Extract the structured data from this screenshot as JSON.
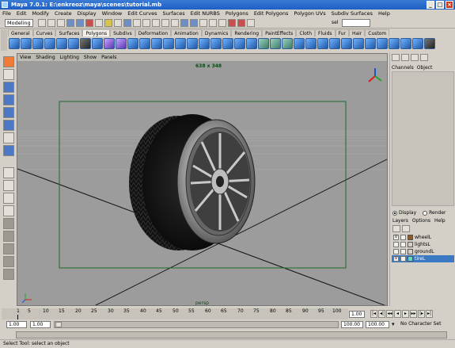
{
  "window": {
    "title": "Maya 7.0.1: E:\\enkreoz\\maya\\scenes\\tutorial.mb"
  },
  "menubar": [
    "File",
    "Edit",
    "Modify",
    "Create",
    "Display",
    "Window",
    "Edit Curves",
    "Surfaces",
    "Edit NURBS",
    "Polygons",
    "Edit Polygons",
    "Polygon UVs",
    "Subdiv Surfaces",
    "Help"
  ],
  "status_line": {
    "mode": "Modeling",
    "sel_label": "sel"
  },
  "shelf_tabs": [
    "General",
    "Curves",
    "Surfaces",
    "Polygons",
    "Subdivs",
    "Deformation",
    "Animation",
    "Dynamics",
    "Rendering",
    "PaintEffects",
    "Cloth",
    "Fluids",
    "Fur",
    "Hair",
    "Custom"
  ],
  "active_shelf": "Polygons",
  "viewport": {
    "menu": [
      "View",
      "Shading",
      "Lighting",
      "Show",
      "Panels"
    ],
    "resolution_gate": "638 x 348",
    "camera": "persp"
  },
  "channel_box": {
    "tabs": [
      "Channels",
      "Object"
    ]
  },
  "layer_editor": {
    "display_label": "Display",
    "render_label": "Render",
    "menu": [
      "Layers",
      "Options",
      "Help"
    ],
    "layers": [
      {
        "visible": "V",
        "name": "wheelL",
        "color": "#8a5a2b",
        "selected": false
      },
      {
        "visible": "",
        "name": "lightsL",
        "color": "#d4d0c8",
        "selected": false
      },
      {
        "visible": "",
        "name": "groundL",
        "color": "#d4d0c8",
        "selected": false
      },
      {
        "visible": "V",
        "name": "tireL",
        "color": "#6fd3c4",
        "selected": true
      }
    ]
  },
  "time_slider": {
    "ticks": [
      "1",
      "5",
      "10",
      "15",
      "20",
      "25",
      "30",
      "35",
      "40",
      "45",
      "50",
      "55",
      "60",
      "65",
      "70",
      "75",
      "80",
      "85",
      "90",
      "95",
      "100"
    ],
    "current_frame": "1.00"
  },
  "range_slider": {
    "start": "1.00",
    "playback_start": "1.00",
    "playback_end": "100.00",
    "end": "100.00",
    "character_set": "No Character Set"
  },
  "help_line": "Select Tool: select an object",
  "colors": {
    "viewport_bg": "#9c9c9c",
    "resolution_gate": "#1f6a2a",
    "selected_layer": "#3b79c2"
  }
}
